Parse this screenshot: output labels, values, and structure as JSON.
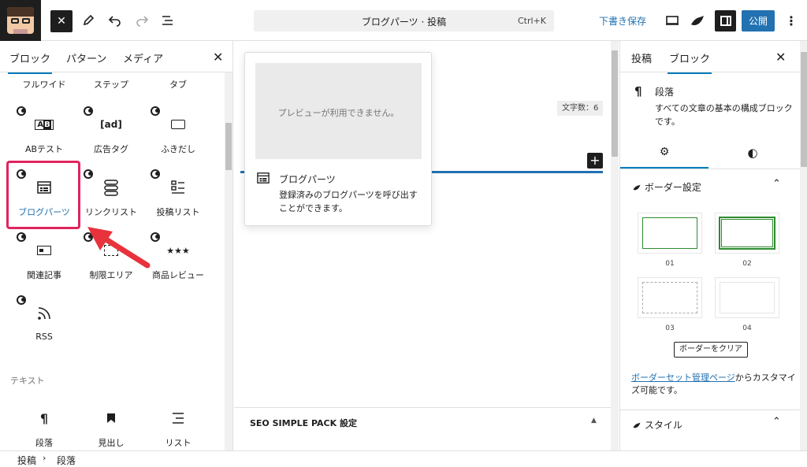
{
  "topbar": {
    "command_title": "ブログパーツ · 投稿",
    "shortcut": "Ctrl+K",
    "save_draft": "下書き保存",
    "publish": "公開"
  },
  "inserter": {
    "tabs": [
      "ブロック",
      "パターン",
      "メディア"
    ],
    "blocks": [
      {
        "label": "フルワイド"
      },
      {
        "label": "ステップ"
      },
      {
        "label": "タブ"
      },
      {
        "label": "ABテスト"
      },
      {
        "label": "広告タグ"
      },
      {
        "label": "ふきだし"
      },
      {
        "label": "ブログパーツ"
      },
      {
        "label": "リンクリスト"
      },
      {
        "label": "投稿リスト"
      },
      {
        "label": "関連記事"
      },
      {
        "label": "制限エリア"
      },
      {
        "label": "商品レビュー"
      },
      {
        "label": "RSS"
      }
    ],
    "text_section": "テキスト",
    "text_blocks": [
      {
        "label": "段落"
      },
      {
        "label": "見出し"
      },
      {
        "label": "リスト"
      }
    ]
  },
  "preview": {
    "unavailable": "プレビューが利用できません。",
    "block_title": "ブログパーツ",
    "block_desc": "登録済みのブログパーツを呼び出すことができます。"
  },
  "canvas": {
    "char_count": "文字数：6",
    "seo_panel": "SEO SIMPLE PACK 設定"
  },
  "settings": {
    "tabs": [
      "投稿",
      "ブロック"
    ],
    "block_name": "段落",
    "block_desc": "すべての文章の基本の構成ブロックです。",
    "border_section": "ボーダー設定",
    "border_options": [
      "01",
      "02",
      "03",
      "04"
    ],
    "clear_button": "ボーダーをクリア",
    "manage_link": "ボーダーセット管理ページ",
    "manage_suffix": "からカスタマイズ可能です。",
    "style_section": "スタイル"
  },
  "breadcrumb": [
    "投稿",
    "段落"
  ],
  "colors": {
    "accent": "#2271b1",
    "highlight": "#e0245e",
    "arrow": "#e8323c",
    "tab_underline": "#007cba"
  }
}
